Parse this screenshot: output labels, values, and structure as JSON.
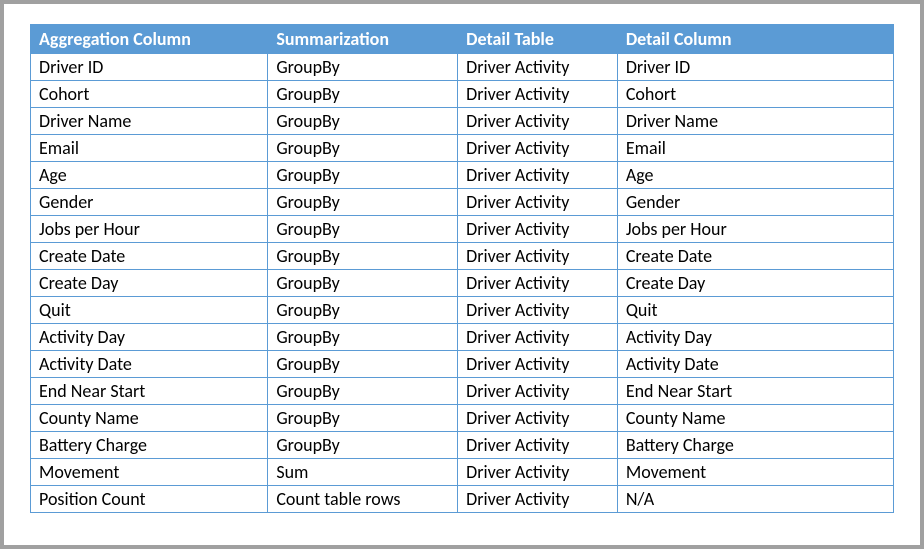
{
  "table": {
    "headers": {
      "aggregation_column": "Aggregation Column",
      "summarization": "Summarization",
      "detail_table": "Detail Table",
      "detail_column": "Detail Column"
    },
    "rows": [
      {
        "aggregation_column": "Driver ID",
        "summarization": "GroupBy",
        "detail_table": "Driver Activity",
        "detail_column": "Driver ID"
      },
      {
        "aggregation_column": "Cohort",
        "summarization": "GroupBy",
        "detail_table": "Driver Activity",
        "detail_column": "Cohort"
      },
      {
        "aggregation_column": "Driver Name",
        "summarization": "GroupBy",
        "detail_table": "Driver Activity",
        "detail_column": "Driver Name"
      },
      {
        "aggregation_column": "Email",
        "summarization": "GroupBy",
        "detail_table": "Driver Activity",
        "detail_column": "Email"
      },
      {
        "aggregation_column": "Age",
        "summarization": "GroupBy",
        "detail_table": "Driver Activity",
        "detail_column": "Age"
      },
      {
        "aggregation_column": "Gender",
        "summarization": "GroupBy",
        "detail_table": "Driver Activity",
        "detail_column": "Gender"
      },
      {
        "aggregation_column": "Jobs per Hour",
        "summarization": "GroupBy",
        "detail_table": "Driver Activity",
        "detail_column": "Jobs per Hour"
      },
      {
        "aggregation_column": "Create Date",
        "summarization": "GroupBy",
        "detail_table": "Driver Activity",
        "detail_column": "Create Date"
      },
      {
        "aggregation_column": "Create Day",
        "summarization": "GroupBy",
        "detail_table": "Driver Activity",
        "detail_column": "Create Day"
      },
      {
        "aggregation_column": "Quit",
        "summarization": "GroupBy",
        "detail_table": "Driver Activity",
        "detail_column": "Quit"
      },
      {
        "aggregation_column": "Activity Day",
        "summarization": "GroupBy",
        "detail_table": "Driver Activity",
        "detail_column": "Activity Day"
      },
      {
        "aggregation_column": "Activity Date",
        "summarization": "GroupBy",
        "detail_table": "Driver Activity",
        "detail_column": "Activity Date"
      },
      {
        "aggregation_column": "End Near Start",
        "summarization": "GroupBy",
        "detail_table": "Driver Activity",
        "detail_column": "End Near Start"
      },
      {
        "aggregation_column": "County Name",
        "summarization": "GroupBy",
        "detail_table": "Driver Activity",
        "detail_column": "County Name"
      },
      {
        "aggregation_column": "Battery Charge",
        "summarization": "GroupBy",
        "detail_table": "Driver Activity",
        "detail_column": "Battery Charge"
      },
      {
        "aggregation_column": "Movement",
        "summarization": "Sum",
        "detail_table": "Driver Activity",
        "detail_column": "Movement"
      },
      {
        "aggregation_column": "Position Count",
        "summarization": "Count table rows",
        "detail_table": "Driver Activity",
        "detail_column": "N/A"
      }
    ]
  }
}
